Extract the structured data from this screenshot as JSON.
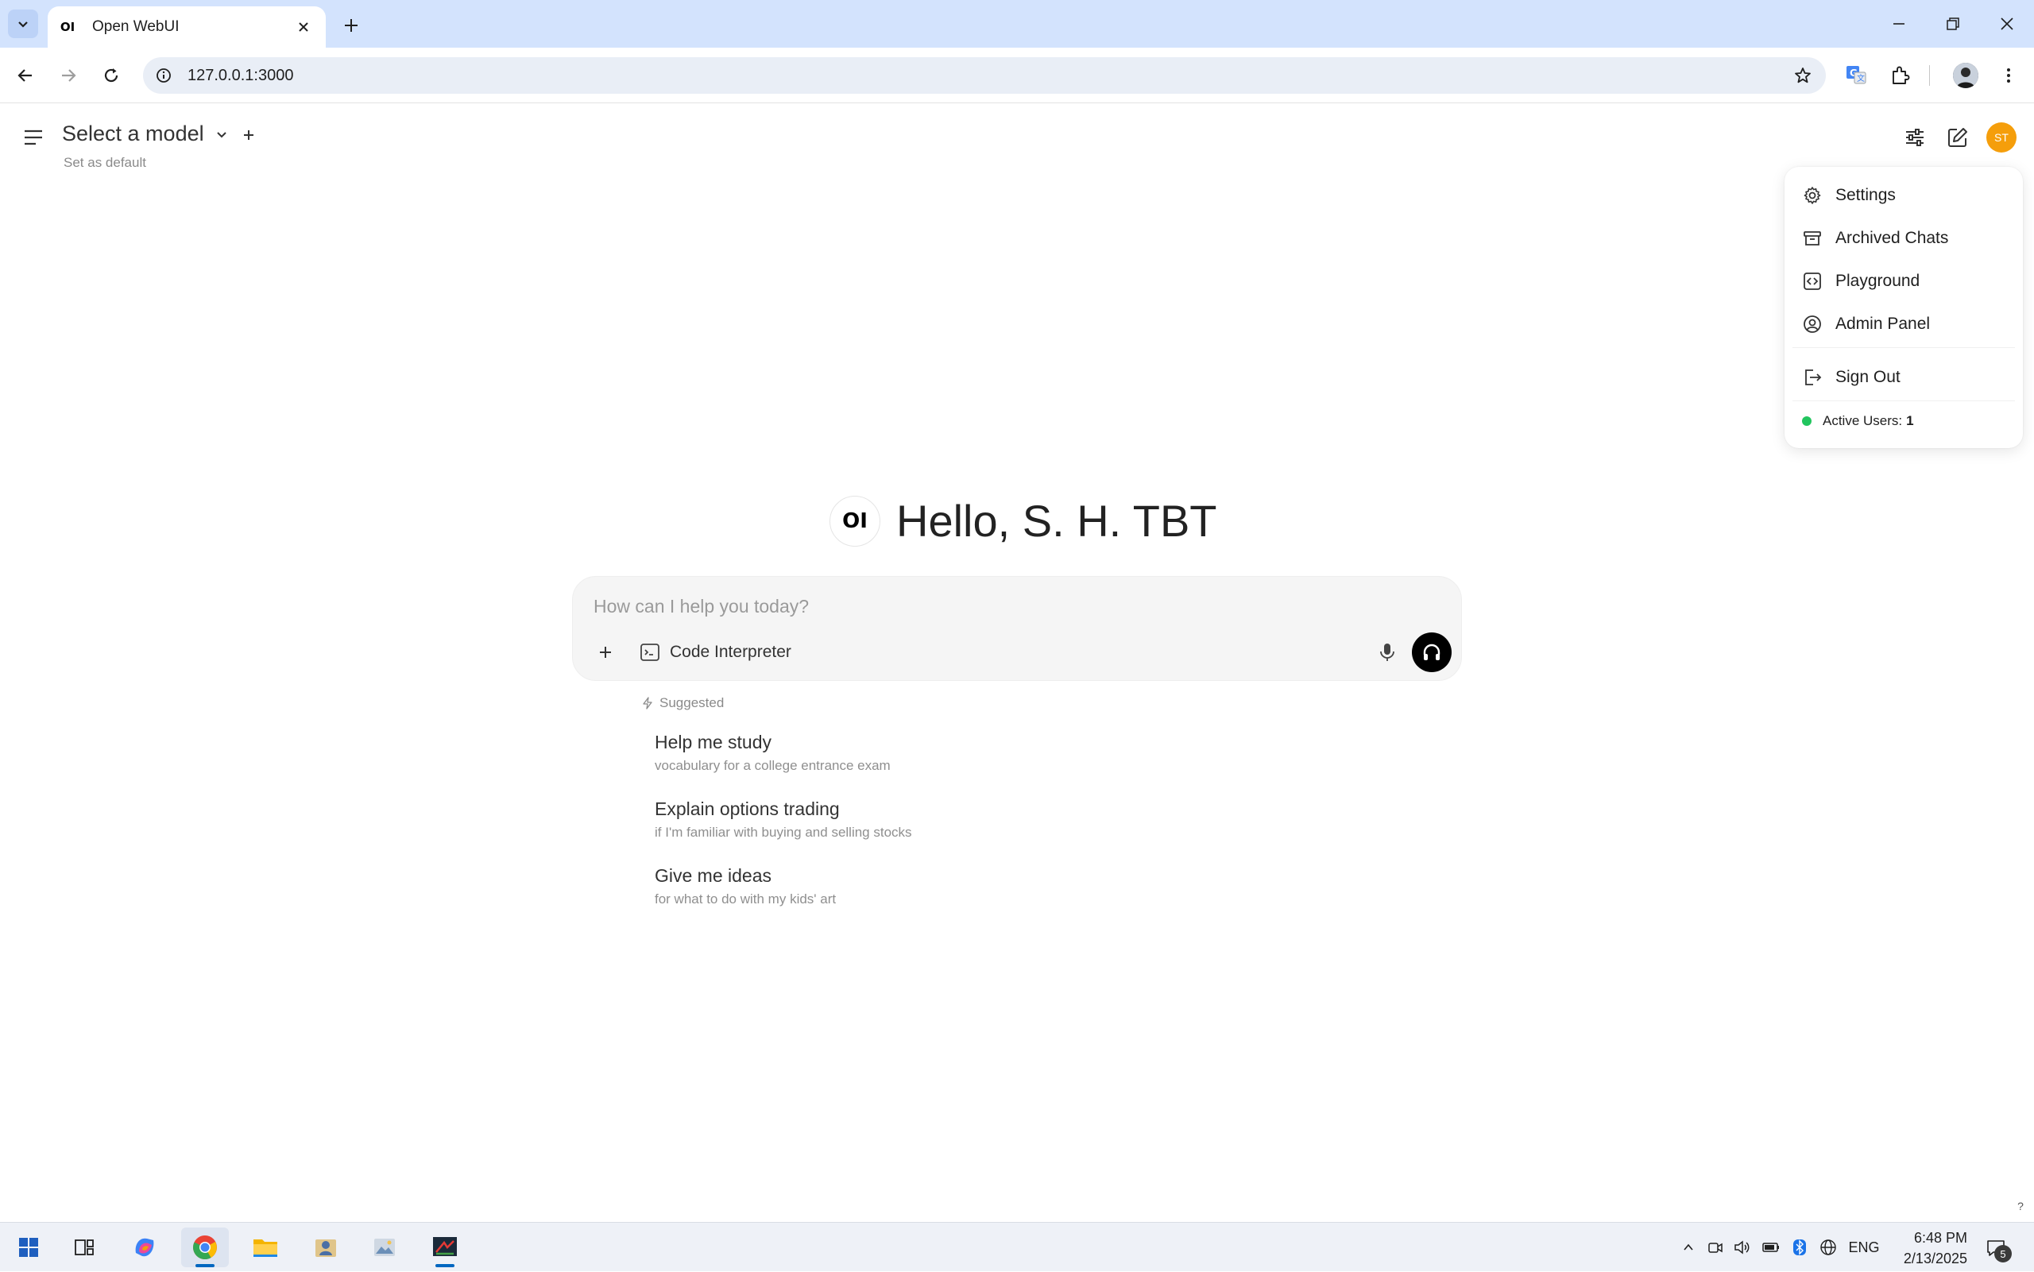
{
  "browser": {
    "tab_title": "Open WebUI",
    "tab_favicon": "OI",
    "url": "127.0.0.1:3000"
  },
  "header": {
    "model_select_label": "Select a model",
    "set_default_label": "Set as default",
    "user_initials": "ST"
  },
  "user_menu": {
    "items": [
      {
        "label": "Settings",
        "icon": "gear-icon"
      },
      {
        "label": "Archived Chats",
        "icon": "archive-icon"
      },
      {
        "label": "Playground",
        "icon": "code-icon"
      },
      {
        "label": "Admin Panel",
        "icon": "user-circle-icon"
      },
      {
        "label": "Sign Out",
        "icon": "sign-out-icon"
      }
    ],
    "active_users_label": "Active Users:",
    "active_users_count": "1"
  },
  "main": {
    "logo_text": "OI",
    "greeting": "Hello, S. H. TBT",
    "input_placeholder": "How can I help you today?",
    "code_interpreter_label": "Code Interpreter",
    "suggested_label": "Suggested",
    "suggestions": [
      {
        "title": "Help me study",
        "subtitle": "vocabulary for a college entrance exam"
      },
      {
        "title": "Explain options trading",
        "subtitle": "if I'm familiar with buying and selling stocks"
      },
      {
        "title": "Give me ideas",
        "subtitle": "for what to do with my kids' art"
      }
    ],
    "help_label": "?"
  },
  "taskbar": {
    "language": "ENG",
    "time": "6:48 PM",
    "date": "2/13/2025",
    "notification_count": "5"
  },
  "colors": {
    "avatar": "#f59e0b",
    "active_dot": "#22c55e",
    "tabstrip": "#d3e3fd"
  }
}
